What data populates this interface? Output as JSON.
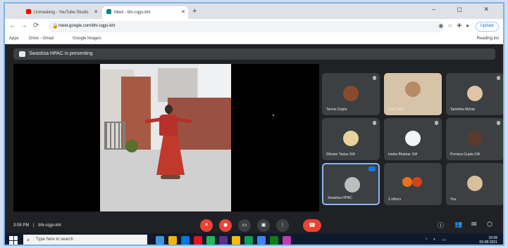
{
  "browser": {
    "tabs": [
      {
        "label": "Unmasking - YouTube Studio",
        "favicon_color": "#ff0000"
      },
      {
        "label": "Meet - bhi-cqgs-khr",
        "favicon_color": "#00897b"
      }
    ],
    "new_tab_glyph": "+",
    "window_controls": "– ◻ ✕",
    "url": "meet.google.com/bhi-cqgs-khr",
    "update_label": "Update",
    "bookmarks": [
      "Apps",
      "Drive - Gmail",
      "Google Images"
    ],
    "reading_list": "Reading list"
  },
  "meet": {
    "banner_text": "Swastisa HPAC is presenting",
    "participants": [
      {
        "name": "Tannis Gupta",
        "avatar_color": "#8a4b2d"
      },
      {
        "name": "Iram Jaha",
        "avatar_color": "#c5a27b",
        "photo": true
      },
      {
        "name": "Tanishka Mehta",
        "avatar_color": "#e0c4a8"
      },
      {
        "name": "Shivani Yadav XIA",
        "avatar_color": "#e8d29a"
      },
      {
        "name": "Isisha Bhatnar XIA",
        "avatar_color": "#f1f3f4"
      },
      {
        "name": "Prerana Gupta XIA",
        "avatar_color": "#5a3a2e"
      },
      {
        "name": "Swastisa HPAC",
        "avatar_color": "#bdbdbd",
        "active": true
      },
      {
        "name": "2 others",
        "avatar_color": "#e8711a"
      },
      {
        "name": "You",
        "avatar_color": "#d8c09a"
      }
    ],
    "time_label": "3:08 PM",
    "meeting_code": "bhi-cqgs-khr",
    "controls": [
      "mic-off",
      "cam-off",
      "captions",
      "present",
      "more",
      "end-call"
    ]
  },
  "taskbar": {
    "search_placeholder": "Type here to search",
    "clock": "15:08",
    "date": "06-08-2021",
    "app_colors": [
      "#3a96dd",
      "#f4b400",
      "#0078d7",
      "#e81123",
      "#1db954",
      "#5c2d91",
      "#ffb900",
      "#0f9d58",
      "#4285f4",
      "#107c10",
      "#c239b3"
    ]
  }
}
